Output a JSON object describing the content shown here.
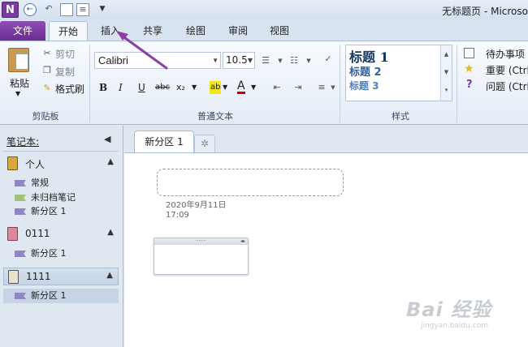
{
  "titlebar": {
    "app_icon": "N",
    "title": "无标题页 - Microso"
  },
  "tabs": {
    "file": "文件",
    "home": "开始",
    "insert": "插入",
    "share": "共享",
    "draw": "绘图",
    "review": "审阅",
    "view": "视图"
  },
  "clipboard": {
    "paste": "粘贴",
    "cut": "剪切",
    "copy": "复制",
    "format_painter": "格式刷",
    "group_label": "剪贴板"
  },
  "basic_text": {
    "font": "Calibri",
    "size": "10.5",
    "bold": "B",
    "italic": "I",
    "underline": "U",
    "strike": "abc",
    "subscript": "x₂",
    "highlight": "ab",
    "font_color": "A",
    "group_label": "普通文本"
  },
  "styles": {
    "h1": "标题 1",
    "h2": "标题 2",
    "h3": "标题 3",
    "group_label": "样式"
  },
  "tags": {
    "todo": "待办事项",
    "important": "重要 (Ctrl",
    "question": "问题 (Ctrl"
  },
  "notebooks": {
    "header": "笔记本:",
    "items": [
      {
        "name": "个人",
        "color": "#d7a93a",
        "sections": [
          {
            "name": "常规",
            "color": "#8f86c4"
          },
          {
            "name": "未归档笔记",
            "color": "#9fc27a"
          },
          {
            "name": "新分区 1",
            "color": "#8f86c4"
          }
        ]
      },
      {
        "name": "0111",
        "color": "#d98aa0",
        "sections": [
          {
            "name": "新分区 1",
            "color": "#8f86c4"
          }
        ]
      },
      {
        "name": "1111",
        "color": "#e8e2cf",
        "sections": [
          {
            "name": "新分区 1",
            "color": "#8f86c4"
          }
        ]
      }
    ]
  },
  "section_tabs": {
    "active": "新分区 1",
    "new_tab_icon": "✲"
  },
  "page": {
    "date": "2020年9月11日",
    "time": "17:09",
    "note_bar": "·······"
  },
  "watermark": {
    "big": "Bai 经验",
    "small": "jingyan.baidu.com"
  },
  "colors": {
    "file_tab": "#7a3b9e",
    "accent": "#2b579a",
    "arrow": "#8b3fa3"
  }
}
